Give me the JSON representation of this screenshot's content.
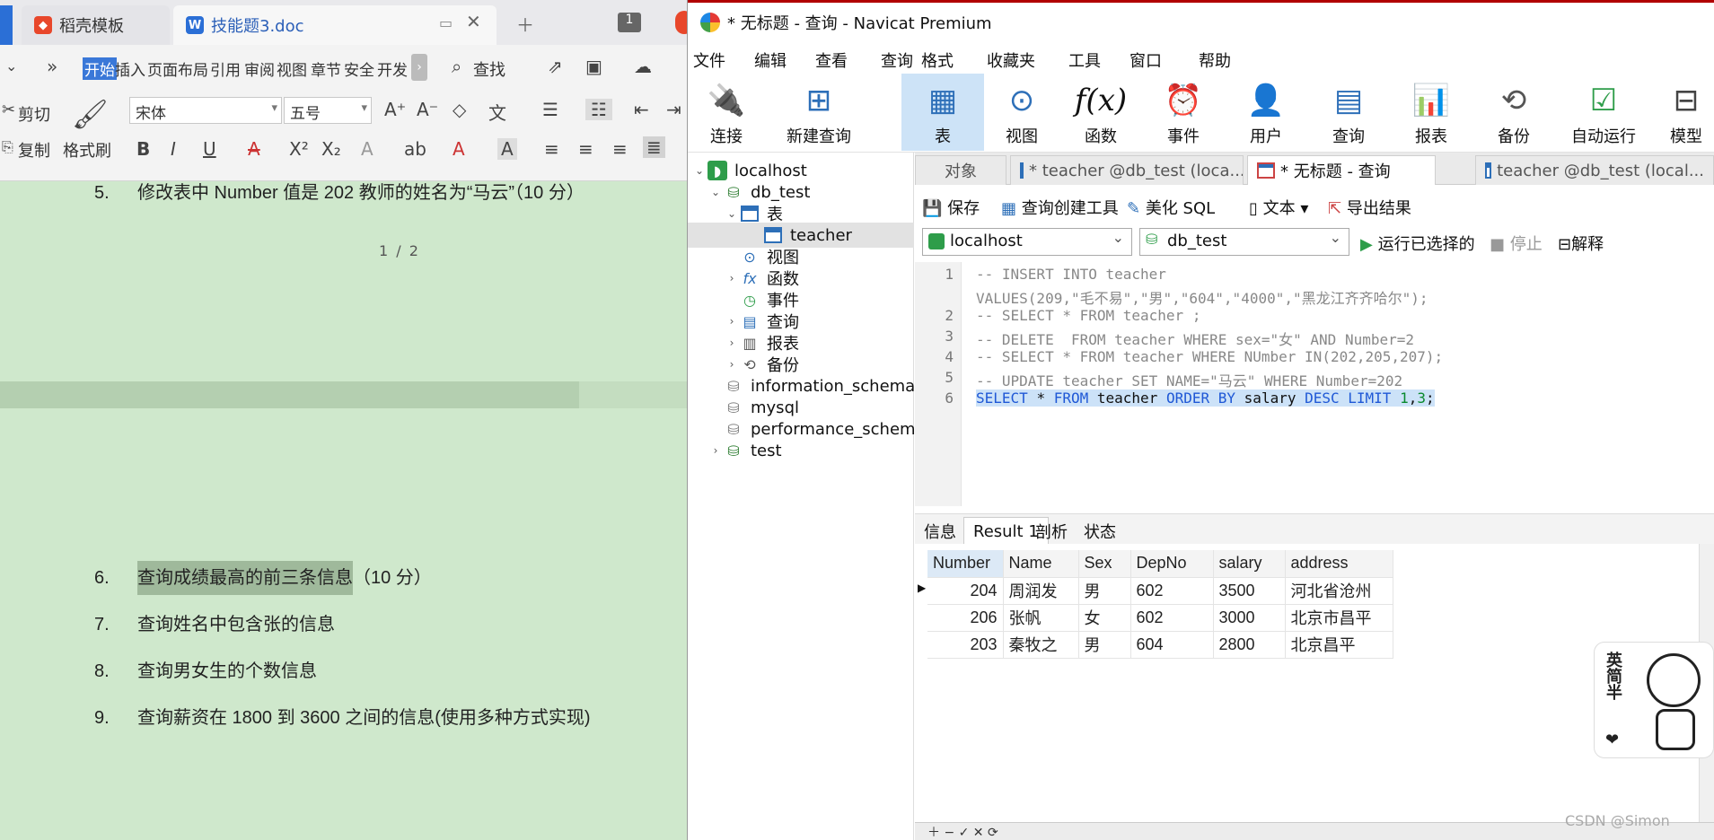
{
  "wps": {
    "tabs": [
      {
        "label": "稻壳模板",
        "icon": "daoke-icon"
      },
      {
        "label": "技能题3.doc",
        "icon": "wps-writer-icon"
      }
    ],
    "tab_count_badge": "1",
    "ribbon_tabs": [
      "开始",
      "插入",
      "页面布局",
      "引用",
      "审阅",
      "视图",
      "章节",
      "安全",
      "开发"
    ],
    "search_label": "查找",
    "cut_label": "剪切",
    "copy_label": "复制",
    "format_painter_label": "格式刷",
    "font_name": "宋体",
    "font_size": "五号",
    "page_indicator": "1 / 2",
    "lines": [
      {
        "num": "5.",
        "text": "修改表中 Number 值是 202 教师的姓名为“马云”（10 分）"
      },
      {
        "num": "6.",
        "text": "查询成绩最高的前三条信息",
        "suffix": "（10 分）"
      },
      {
        "num": "7.",
        "text": "查询姓名中包含张的信息"
      },
      {
        "num": "8.",
        "text": "查询男女生的个数信息"
      },
      {
        "num": "9.",
        "text": "查询薪资在 1800 到 3600 之间的信息(使用多种方式实现)"
      }
    ]
  },
  "navicat": {
    "title": "* 无标题 - 查询 - Navicat Premium",
    "menu": [
      "文件",
      "编辑",
      "查看",
      "查询",
      "格式",
      "收藏夹",
      "工具",
      "窗口",
      "帮助"
    ],
    "toolbar": [
      "连接",
      "新建查询",
      "表",
      "视图",
      "函数",
      "事件",
      "用户",
      "查询",
      "报表",
      "备份",
      "自动运行",
      "模型"
    ],
    "tree": {
      "connection": "localhost",
      "database": "db_test",
      "tables_group": "表",
      "table": "teacher",
      "views": "视图",
      "functions": "函数",
      "events": "事件",
      "queries": "查询",
      "reports": "报表",
      "backups": "备份",
      "other_dbs": [
        "information_schema",
        "mysql",
        "performance_schema",
        "test"
      ]
    },
    "doc_tabs": [
      "对象",
      "* teacher @db_test (loca...",
      "* 无标题 - 查询",
      "teacher @db_test (local..."
    ],
    "query_toolbar": {
      "save": "保存",
      "builder": "查询创建工具",
      "beautify": "美化 SQL",
      "text": "文本",
      "export": "导出结果"
    },
    "connection_select": "localhost",
    "database_select": "db_test",
    "run_selected": "运行已选择的",
    "stop": "停止",
    "explain": "解释",
    "code_lines": [
      {
        "n": "1",
        "text": "-- INSERT INTO teacher"
      },
      {
        "n": "",
        "text": "VALUES(209,\"毛不易\",\"男\",\"604\",\"4000\",\"黑龙江齐齐哈尔\");"
      },
      {
        "n": "2",
        "text": "-- SELECT * FROM teacher ;"
      },
      {
        "n": "3",
        "text": "-- DELETE  FROM teacher WHERE sex=\"女\" AND Number=2"
      },
      {
        "n": "4",
        "text": "-- SELECT * FROM teacher WHERE NUmber IN(202,205,207);"
      },
      {
        "n": "5",
        "text": "-- UPDATE teacher SET NAME=\"马云\" WHERE Number=202"
      },
      {
        "n": "6",
        "text": "SELECT * FROM teacher ORDER BY salary DESC LIMIT 1,3;"
      }
    ],
    "result_tabs": [
      "信息",
      "Result 1",
      "剖析",
      "状态"
    ],
    "columns": [
      "Number",
      "Name",
      "Sex",
      "DepNo",
      "salary",
      "address"
    ],
    "rows": [
      [
        "204",
        "周润发",
        "男",
        "602",
        "3500",
        "河北省沧州"
      ],
      [
        "206",
        "张帆",
        "女",
        "602",
        "3000",
        "北京市昌平"
      ],
      [
        "203",
        "秦牧之",
        "男",
        "604",
        "2800",
        "北京昌平"
      ]
    ]
  },
  "sticker_text": "英简半",
  "watermark": "CSDN @Simon"
}
